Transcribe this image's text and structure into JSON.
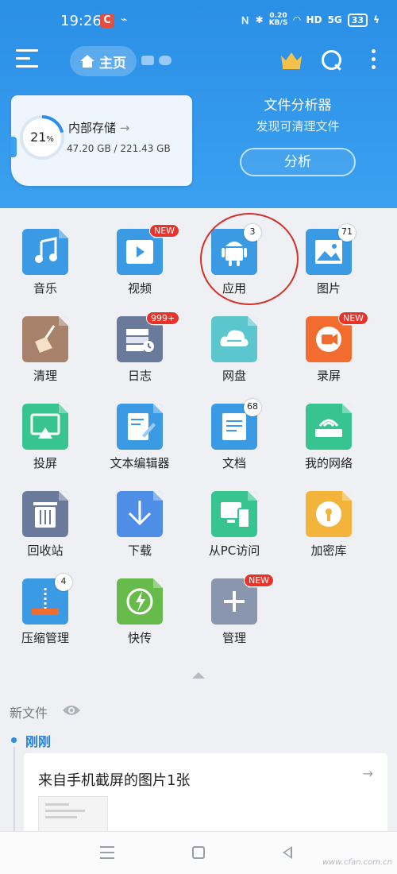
{
  "status_bar": {
    "time": "19:26",
    "app_icon_letter": "C",
    "net_speed_value": "0.20",
    "net_speed_unit": "KB/S",
    "network_label": "HD",
    "signal_label": "5G",
    "battery": "33"
  },
  "toolbar": {
    "home_label": "主页",
    "icons": [
      "menu-icon",
      "home-icon",
      "crown-icon",
      "search-icon",
      "more-icon"
    ]
  },
  "storage": {
    "percent": "21",
    "percent_sign": "%",
    "percent_value": 0.21,
    "title": "内部存储",
    "arrow": "→",
    "usage": "47.20 GB / 221.43 GB"
  },
  "analyzer": {
    "title": "文件分析器",
    "subtitle": "发现可清理文件",
    "button": "分析"
  },
  "grid": {
    "tiles": [
      {
        "label": "音乐",
        "icon": "music-icon",
        "color": "#3b9ae4",
        "badge": ""
      },
      {
        "label": "视频",
        "icon": "video-icon",
        "color": "#3b9ae4",
        "badge": "NEW"
      },
      {
        "label": "应用",
        "icon": "android-icon",
        "color": "#3b9ae4",
        "badge": "3"
      },
      {
        "label": "图片",
        "icon": "image-icon",
        "color": "#3b9ae4",
        "badge": "71"
      },
      {
        "label": "清理",
        "icon": "broom-icon",
        "color": "#a7816a",
        "badge": ""
      },
      {
        "label": "日志",
        "icon": "log-icon",
        "color": "#6a7a9b",
        "badge": "999+"
      },
      {
        "label": "网盘",
        "icon": "cloud-icon",
        "color": "#5cc6cf",
        "badge": ""
      },
      {
        "label": "录屏",
        "icon": "record-icon",
        "color": "#f26b2f",
        "badge": "NEW"
      },
      {
        "label": "投屏",
        "icon": "cast-icon",
        "color": "#38c491",
        "badge": ""
      },
      {
        "label": "文本编辑器",
        "icon": "editor-icon",
        "color": "#3b9ae4",
        "badge": ""
      },
      {
        "label": "文档",
        "icon": "document-icon",
        "color": "#3b9ae4",
        "badge": "68"
      },
      {
        "label": "我的网络",
        "icon": "network-icon",
        "color": "#38c491",
        "badge": ""
      },
      {
        "label": "回收站",
        "icon": "trash-icon",
        "color": "#6a7a9b",
        "badge": ""
      },
      {
        "label": "下载",
        "icon": "download-icon",
        "color": "#4f8ee6",
        "badge": ""
      },
      {
        "label": "从PC访问",
        "icon": "pc-access-icon",
        "color": "#38c491",
        "badge": ""
      },
      {
        "label": "加密库",
        "icon": "lock-icon",
        "color": "#f2b43a",
        "badge": ""
      },
      {
        "label": "压缩管理",
        "icon": "zip-icon",
        "color": "#3b9ae4",
        "badge": "4"
      },
      {
        "label": "快传",
        "icon": "transfer-icon",
        "color": "#66bb4a",
        "badge": ""
      },
      {
        "label": "管理",
        "icon": "add-icon",
        "color": "#8a96ad",
        "badge": "NEW"
      }
    ]
  },
  "recent": {
    "title": "新文件",
    "time_label": "刚刚",
    "card_title": "来自手机截屏的图片1张",
    "card_arrow": "→"
  },
  "watermark": "www.cfan.com.cn"
}
